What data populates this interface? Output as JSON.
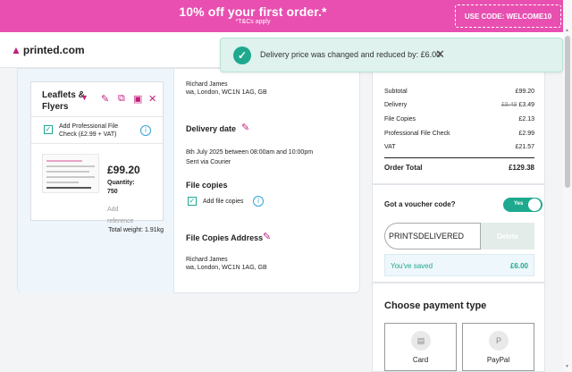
{
  "promo": {
    "title": "10% off your first order.*",
    "subtitle": "*T&Cs apply",
    "code_label": "USE CODE: WELCOME10"
  },
  "header": {
    "logo_text": "printed.com"
  },
  "toast": {
    "message": "Delivery price was changed and reduced by: £6.00"
  },
  "product": {
    "name": "Leaflets & Flyers",
    "pfc_label": "Add Professional File Check (£2.99 + VAT)",
    "price": "£99.20",
    "quantity_label": "Quantity:",
    "quantity_value": "750",
    "add_reference": "Add reference",
    "total_weight": "Total weight: 1.91kg"
  },
  "delivery": {
    "recipient_name": "Richard James",
    "recipient_address": "wa, London, WC1N 1AG, GB",
    "date_heading": "Delivery date",
    "date_text": "8th July 2025 between 08:00am and 10:00pm",
    "method": "Sent via Courier",
    "file_copies_heading": "File copies",
    "add_file_copies": "Add file copies",
    "file_copies_address_heading": "File Copies Address",
    "fc_name": "Richard James",
    "fc_address": "wa, London, WC1N 1AG, GB"
  },
  "summary": {
    "rows": [
      {
        "label": "Subtotal",
        "value": "£99.20",
        "old": ""
      },
      {
        "label": "Delivery",
        "value": "£3.49",
        "old": "£9.49"
      },
      {
        "label": "File Copies",
        "value": "£2.13",
        "old": ""
      },
      {
        "label": "Professional File Check",
        "value": "£2.99",
        "old": ""
      },
      {
        "label": "VAT",
        "value": "£21.57",
        "old": ""
      }
    ],
    "total_label": "Order Total",
    "total_value": "£129.38"
  },
  "voucher": {
    "title": "Got a voucher code?",
    "toggle_label": "Yes",
    "code_value": "PRINTSDELIVERED",
    "delete_label": "Delete",
    "saved_label": "You've saved",
    "saved_value": "£6.00"
  },
  "payment": {
    "title": "Choose payment type",
    "options": [
      {
        "label": "Card",
        "icon": "card-icon"
      },
      {
        "label": "PayPal",
        "icon": "paypal-icon"
      }
    ]
  },
  "colors": {
    "brand_pink": "#e84fb0",
    "accent_magenta": "#c21f7d",
    "success_teal": "#1ea98e",
    "info_blue": "#33a3d7"
  }
}
